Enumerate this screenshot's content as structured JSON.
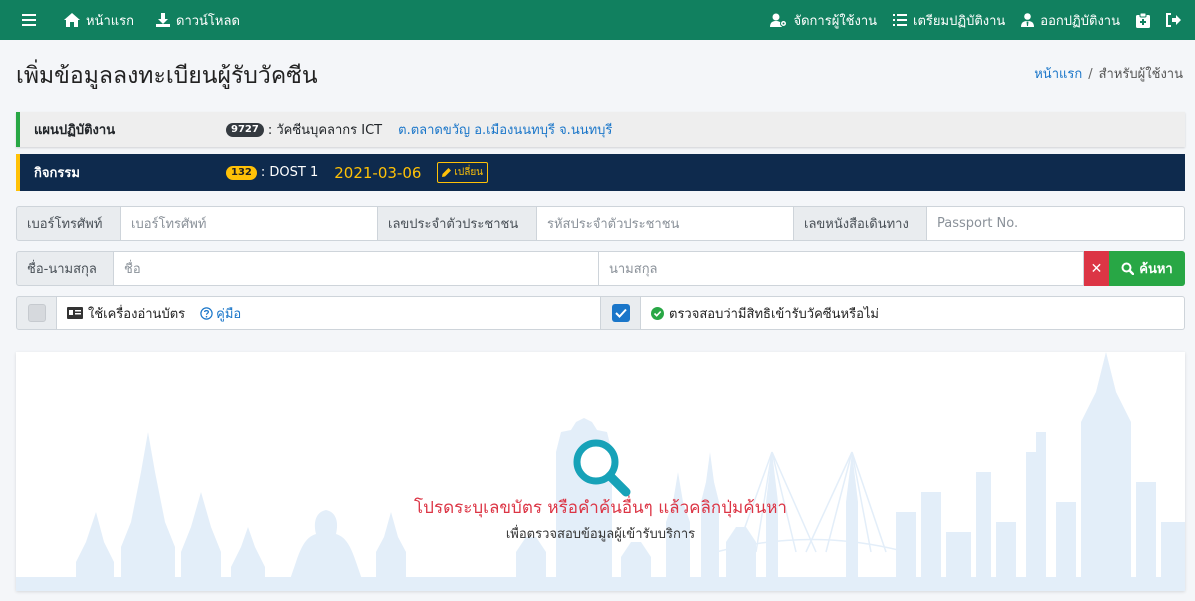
{
  "nav": {
    "home": "หน้าแรก",
    "download": "ดาวน์โหลด",
    "manage_users": "จัดการผู้ใช้งาน",
    "prepare": "เตรียมปฏิบัติงาน",
    "go_operate": "ออกปฏิบัติงาน"
  },
  "page": {
    "title": "เพิ่มข้อมูลลงทะเบียนผู้รับวัคซีน"
  },
  "breadcrumb": {
    "home": "หน้าแรก",
    "separator": "/",
    "current": "สำหรับผู้ใช้งาน"
  },
  "plan": {
    "label": "แผนปฏิบัติงาน",
    "code": "9727",
    "name": ": วัคซีนบุคลากร ICT",
    "location": "ต.ตลาดขวัญ อ.เมืองนนทบุรี จ.นนทบุรี"
  },
  "activity": {
    "label": "กิจกรรม",
    "code": "132",
    "name": ": DOST 1",
    "date": "2021-03-06",
    "change_label": "เปลี่ยน"
  },
  "search": {
    "phone_label": "เบอร์โทรศัพท์",
    "phone_placeholder": "เบอร์โทรศัพท์",
    "cid_label": "เลขประจำตัวประชาชน",
    "cid_placeholder": "รหัสประจำตัวประชาชน",
    "passport_label": "เลขหนังสือเดินทาง",
    "passport_placeholder": "Passport No.",
    "name_label": "ชื่อ-นามสกุล",
    "first_placeholder": "ชื่อ",
    "last_placeholder": "นามสกุล",
    "clear_label": "✕",
    "search_label": "ค้นหา"
  },
  "options": {
    "card_reader_label": "ใช้เครื่องอ่านบัตร",
    "card_reader_checked": false,
    "manual_label": "คู่มือ",
    "check_rights_label": "ตรวจสอบว่ามีสิทธิเข้ารับวัคซีนหรือไม่",
    "check_rights_checked": true
  },
  "result": {
    "message": "โปรดระบุเลขบัตร หรือคำค้นอื่นๆ แล้วคลิกปุ่มค้นหา",
    "sub_message": "เพื่อตรวจสอบข้อมูลผู้เข้ารับบริการ"
  },
  "colors": {
    "navbar": "#11805f",
    "activity_bg": "#0e2a4d",
    "accent_green": "#28a745",
    "accent_yellow": "#ffc107",
    "danger": "#dc3545",
    "link": "#1a76c9"
  }
}
